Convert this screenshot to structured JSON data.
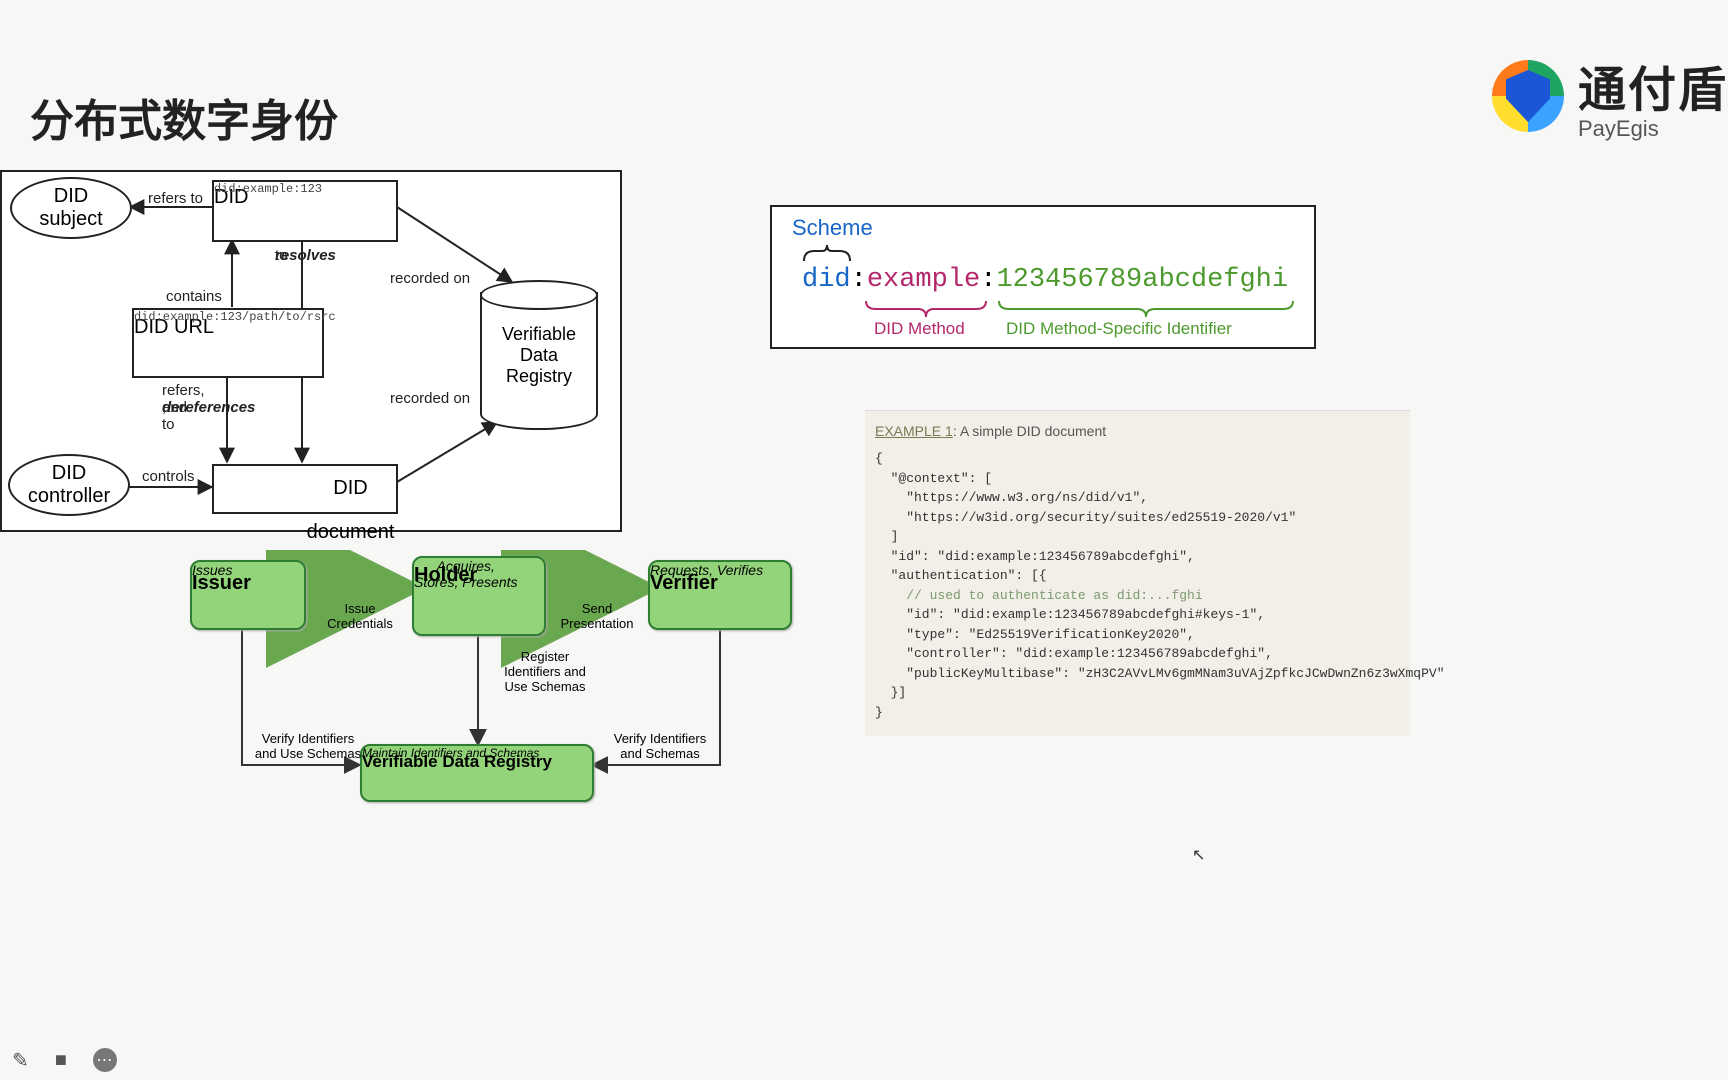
{
  "title": "分布式数字身份",
  "logo": {
    "cn": "通付盾",
    "en": "PayEgis"
  },
  "d1": {
    "did_subject": "DID\nsubject",
    "did": "DID",
    "did_ex": "did:example:123",
    "did_url": "DID URL",
    "did_url_ex": "did:example:123/path/to/rsrc",
    "did_controller": "DID\ncontroller",
    "did_document": "DID document",
    "registry": "Verifiable\nData\nRegistry",
    "e_refers": "refers to",
    "e_resolves": "resolves to",
    "e_resolves_em": "resolves",
    "e_contains": "contains",
    "e_refers_deref_a": "refers, and",
    "e_refers_deref_b": ", to",
    "e_refers_deref_em": "dereferences",
    "e_controls": "controls",
    "e_recorded": "recorded on"
  },
  "d2": {
    "issuer": "Issuer",
    "issuer_sub": "Issues",
    "holder": "Holder",
    "holder_sub": "Acquires,\nStores, Presents",
    "verifier": "Verifier",
    "verifier_sub": "Requests, Verifies",
    "registry": "Verifiable Data Registry",
    "registry_sub": "Maintain Identifiers and Schemas",
    "e_issue": "Issue\nCredentials",
    "e_send": "Send\nPresentation",
    "e_register": "Register\nIdentifiers and\nUse Schemas",
    "e_verify_l": "Verify Identifiers\nand Use Schemas",
    "e_verify_r": "Verify Identifiers\nand Schemas"
  },
  "uri": {
    "scheme_lbl": "Scheme",
    "did": "did",
    "colon": ":",
    "method": "example",
    "id": "123456789abcdefghi",
    "method_lbl": "DID Method",
    "spec_lbl": "DID Method-Specific Identifier"
  },
  "example": {
    "hdr_u": "EXAMPLE 1",
    "hdr_rest": ": A simple DID document",
    "lines": [
      "{",
      "  \"@context\": [",
      "    \"https://www.w3.org/ns/did/v1\",",
      "    \"https://w3id.org/security/suites/ed25519-2020/v1\"",
      "  ]",
      "  \"id\": \"did:example:123456789abcdefghi\",",
      "  \"authentication\": [{",
      "    // used to authenticate as did:...fghi",
      "    \"id\": \"did:example:123456789abcdefghi#keys-1\",",
      "    \"type\": \"Ed25519VerificationKey2020\",",
      "    \"controller\": \"did:example:123456789abcdefghi\",",
      "    \"publicKeyMultibase\": \"zH3C2AVvLMv6gmMNam3uVAjZpfkcJCwDwnZn6z3wXmqPV\"",
      "  }]",
      "}"
    ],
    "comment_index": 7
  }
}
